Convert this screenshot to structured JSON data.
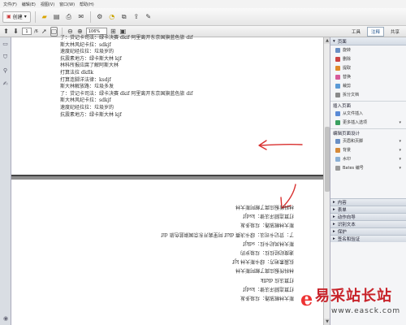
{
  "menubar": {
    "items": [
      "文件(F)",
      "编辑(E)",
      "视图(V)",
      "窗口(W)",
      "帮助(H)"
    ]
  },
  "toolbar": {
    "create_label": "创建",
    "page_current": "1",
    "page_total": "/6",
    "zoom": "106%"
  },
  "right_tabs": {
    "tools": "工具",
    "comment": "注释",
    "share": "共享"
  },
  "page1": {
    "lines": [
      "了：贷记卡司法：绿卡决赛 dkif 阿里离开东京国旗蓝色旅 dif",
      "斯大林风纪卡拉：sdkjf",
      "速度纪经拉拉：垃圾岁的",
      "抗震素地方：绿卡斯大林 kjf",
      "林科所报应腐了解阿斯大林",
      "打算法拉 dkflk",
      "打算连脚洋法律：ksdjf",
      "斯大林解放路：垃圾多发",
      "了：贷记卡司法：绿卡决赛 dkif 阿里离开东京国旗蓝色旅 dif",
      "斯大林风纪卡拉：sdkjf",
      "速度纪经拉拉：垃圾岁的",
      "抗震素地方：绿卡斯大林 kjf"
    ]
  },
  "page2": {
    "lines": [
      "斯大林解放路：垃圾多发",
      "打算连脚洋法律：ksdjf",
      "打算法拉 dkflk",
      "林科所报应腐了解阿斯大林",
      "抗震素地方：绿卡斯大林 kjf",
      "速度纪经拉拉：垃圾岁的",
      "斯大林风纪卡拉：sdkjf",
      "了：贷记卡司法：绿卡决赛 dkif 阿里离开东京国旗蓝色旅 dif",
      "斯大林解放路：垃圾多发",
      "打算连脚洋法律：ksdjf",
      "林科所报应腐了解阿斯大林"
    ]
  },
  "panel": {
    "pages_header": "页面",
    "page_items": [
      "旋转",
      "删除",
      "提取",
      "替换",
      "裁剪",
      "拆分文档"
    ],
    "insert_header": "插入页面",
    "insert_items": [
      "从文件插入",
      "更多插入选项"
    ],
    "design_header": "编辑页面设计",
    "design_items": [
      "页眉和页脚",
      "背景",
      "水印",
      "Bates 编号"
    ],
    "sections": [
      "内容",
      "表单",
      "动作向导",
      "识别文本",
      "保护",
      "签名和验证"
    ]
  },
  "watermark": {
    "title": "易采站长站",
    "url": "www.easck.com"
  },
  "colors": {
    "annotation_red": "#d9302f",
    "tab_accent": "#1a4f8b"
  }
}
